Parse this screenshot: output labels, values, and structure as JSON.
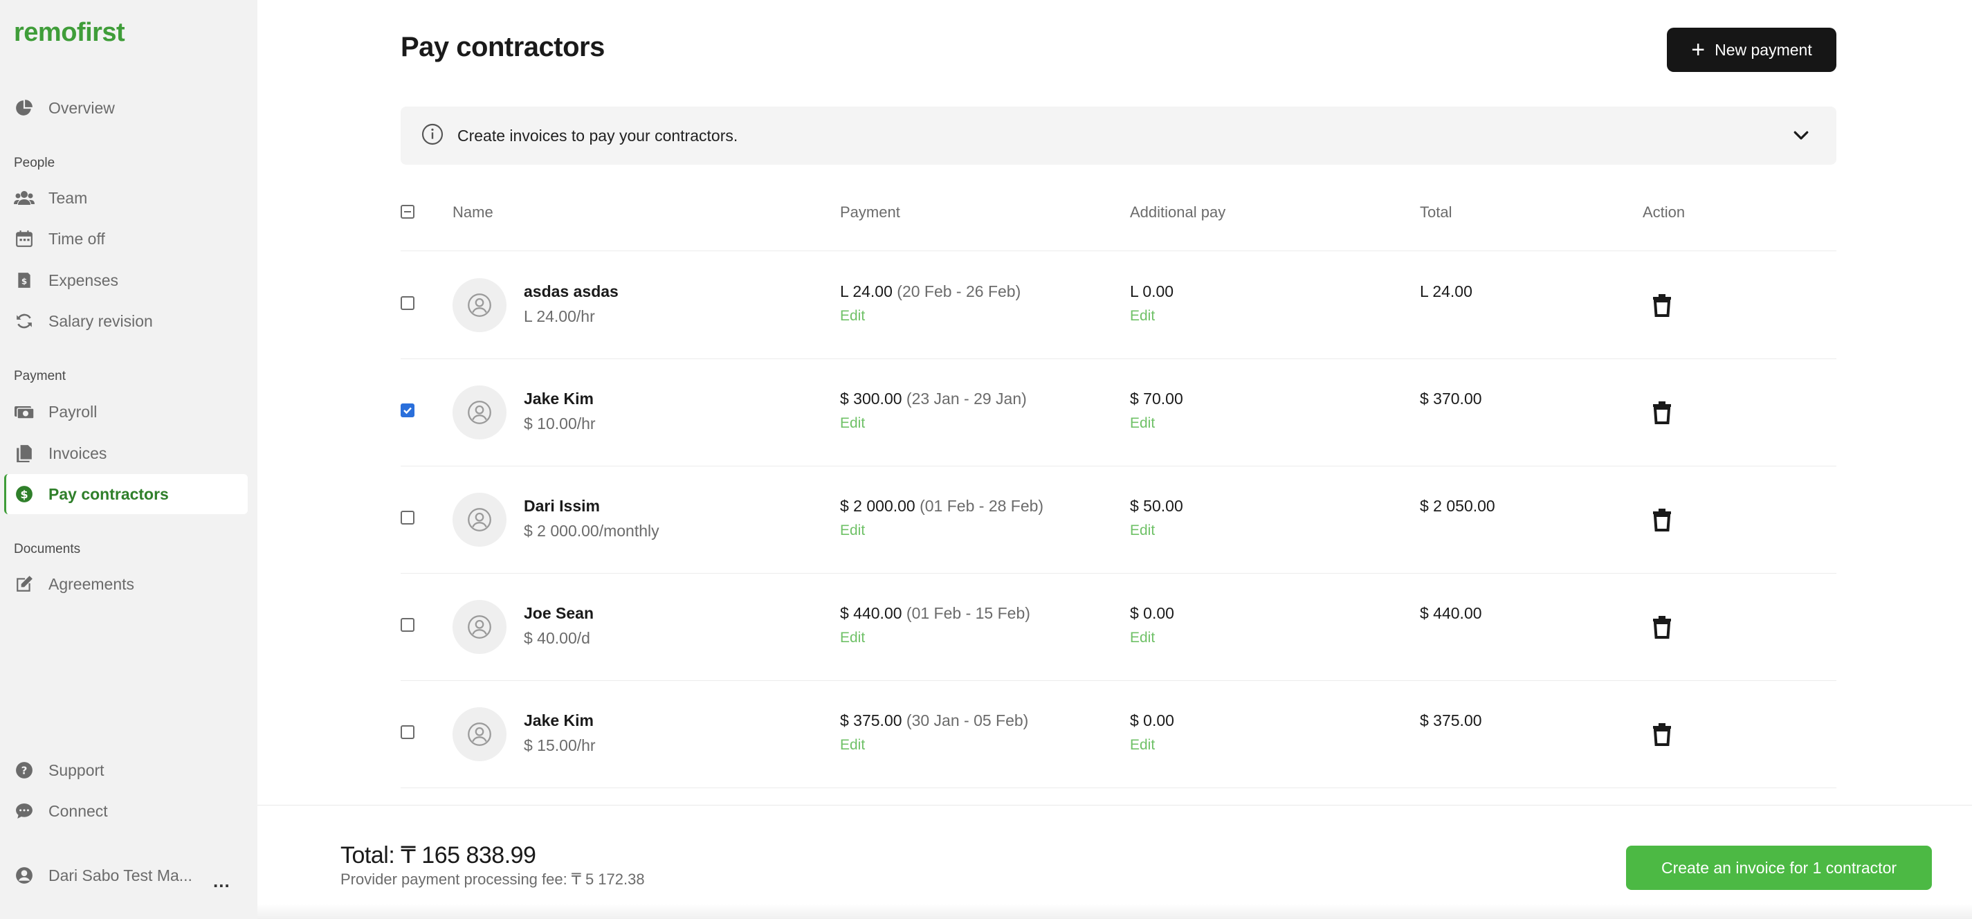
{
  "app": {
    "logo": "remofirst",
    "accent": "#4cb944"
  },
  "sidebar": {
    "overview": "Overview",
    "sections": {
      "people": "People",
      "payment": "Payment",
      "documents": "Documents"
    },
    "people_items": [
      "Team",
      "Time off",
      "Expenses",
      "Salary revision"
    ],
    "payment_items": [
      "Payroll",
      "Invoices",
      "Pay contractors"
    ],
    "documents_items": [
      "Agreements"
    ],
    "bottom_items": [
      "Support",
      "Connect"
    ],
    "user_name": "Dari Sabo Test Ma...",
    "more": "..."
  },
  "header": {
    "title": "Pay contractors",
    "new_payment_label": "New payment"
  },
  "info": {
    "text": "Create invoices to pay your contractors."
  },
  "table": {
    "columns": {
      "name": "Name",
      "payment": "Payment",
      "additional": "Additional pay",
      "total": "Total",
      "action": "Action"
    },
    "edit_label": "Edit",
    "rows": [
      {
        "name": "asdas asdas",
        "rate": "L 24.00/hr",
        "payment": "L 24.00",
        "period": "(20 Feb - 26 Feb)",
        "additional": "L 0.00",
        "total": "L 24.00",
        "checked": false
      },
      {
        "name": "Jake Kim",
        "rate": "$ 10.00/hr",
        "payment": "$ 300.00",
        "period": "(23 Jan - 29 Jan)",
        "additional": "$ 70.00",
        "total": "$ 370.00",
        "checked": true
      },
      {
        "name": "Dari Issim",
        "rate": "$ 2 000.00/monthly",
        "payment": "$ 2 000.00",
        "period": "(01 Feb - 28 Feb)",
        "additional": "$ 50.00",
        "total": "$ 2 050.00",
        "checked": false
      },
      {
        "name": "Joe Sean",
        "rate": "$ 40.00/d",
        "payment": "$ 440.00",
        "period": "(01 Feb - 15 Feb)",
        "additional": "$ 0.00",
        "total": "$ 440.00",
        "checked": false
      },
      {
        "name": "Jake Kim",
        "rate": "$ 15.00/hr",
        "payment": "$ 375.00",
        "period": "(30 Jan - 05 Feb)",
        "additional": "$ 0.00",
        "total": "$ 375.00",
        "checked": false
      }
    ]
  },
  "footer": {
    "total": "Total: ₸ 165 838.99",
    "fee": "Provider payment processing fee: ₸ 5 172.38",
    "create_label": "Create an invoice for 1 contractor"
  }
}
